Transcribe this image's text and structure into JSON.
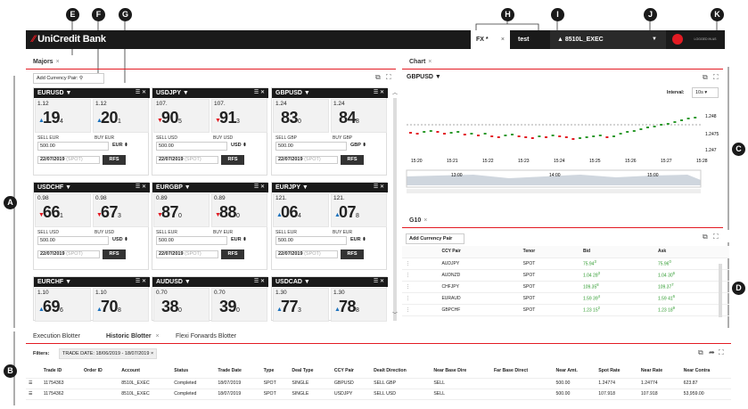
{
  "markers": [
    "A",
    "B",
    "C",
    "D",
    "E",
    "F",
    "G",
    "H",
    "I",
    "J",
    "K"
  ],
  "header": {
    "logo_brand": "UniCredit",
    "logo_sub": "Bank",
    "tab_fx": "FX *",
    "tab_close": "×",
    "tab_test": "test",
    "user": "8510L_EXEC",
    "logged_in": "LOGGED IN AS"
  },
  "majors": {
    "tab": "Majors",
    "close": "×",
    "add_pair": "Add Currency Pair:"
  },
  "tiles": [
    {
      "pair": "EURUSD",
      "bid_big": "1.12",
      "bid_pips": "19",
      "bid_sub": "4",
      "ask_big": "1.12",
      "ask_pips": "20",
      "ask_sub": "1",
      "bid_dir": "up",
      "ask_dir": "up",
      "sell": "SELL EUR",
      "buy": "BUY EUR",
      "amount": "500.00",
      "ccy": "EUR",
      "date": "22/07/2019",
      "spot": "(SPOT)",
      "rfs": "RFS"
    },
    {
      "pair": "USDJPY",
      "bid_big": "107.",
      "bid_pips": "90",
      "bid_sub": "5",
      "ask_big": "107.",
      "ask_pips": "91",
      "ask_sub": "3",
      "bid_dir": "dn",
      "ask_dir": "dn",
      "sell": "SELL USD",
      "buy": "BUY USD",
      "amount": "500.00",
      "ccy": "USD",
      "date": "22/07/2019",
      "spot": "(SPOT)",
      "rfs": "RFS"
    },
    {
      "pair": "GBPUSD",
      "bid_big": "1.24",
      "bid_pips": "83",
      "bid_sub": "0",
      "ask_big": "1.24",
      "ask_pips": "84",
      "ask_sub": "8",
      "bid_dir": "",
      "ask_dir": "",
      "sell": "SELL GBP",
      "buy": "BUY GBP",
      "amount": "500.00",
      "ccy": "GBP",
      "date": "22/07/2019",
      "spot": "(SPOT)",
      "rfs": "RFS"
    },
    {
      "pair": "USDCHF",
      "bid_big": "0.98",
      "bid_pips": "66",
      "bid_sub": "1",
      "ask_big": "0.98",
      "ask_pips": "67",
      "ask_sub": "3",
      "bid_dir": "dn",
      "ask_dir": "dn",
      "sell": "SELL USD",
      "buy": "BUY USD",
      "amount": "500.00",
      "ccy": "USD",
      "date": "22/07/2019",
      "spot": "(SPOT)",
      "rfs": "RFS"
    },
    {
      "pair": "EURGBP",
      "bid_big": "0.89",
      "bid_pips": "87",
      "bid_sub": "0",
      "ask_big": "0.89",
      "ask_pips": "88",
      "ask_sub": "0",
      "bid_dir": "dn",
      "ask_dir": "dn",
      "sell": "SELL EUR",
      "buy": "BUY EUR",
      "amount": "500.00",
      "ccy": "EUR",
      "date": "22/07/2019",
      "spot": "(SPOT)",
      "rfs": "RFS"
    },
    {
      "pair": "EURJPY",
      "bid_big": "121.",
      "bid_pips": "06",
      "bid_sub": "4",
      "ask_big": "121.",
      "ask_pips": "07",
      "ask_sub": "8",
      "bid_dir": "up",
      "ask_dir": "up",
      "sell": "SELL EUR",
      "buy": "BUY EUR",
      "amount": "500.00",
      "ccy": "EUR",
      "date": "22/07/2019",
      "spot": "(SPOT)",
      "rfs": "RFS"
    },
    {
      "pair": "EURCHF",
      "bid_big": "1.10",
      "bid_pips": "69",
      "bid_sub": "6",
      "ask_big": "1.10",
      "ask_pips": "70",
      "ask_sub": "8",
      "bid_dir": "up",
      "ask_dir": "up"
    },
    {
      "pair": "AUDUSD",
      "bid_big": "0.70",
      "bid_pips": "38",
      "bid_sub": "0",
      "ask_big": "0.70",
      "ask_pips": "39",
      "ask_sub": "0",
      "bid_dir": "",
      "ask_dir": ""
    },
    {
      "pair": "USDCAD",
      "bid_big": "1.30",
      "bid_pips": "77",
      "bid_sub": "3",
      "ask_big": "1.30",
      "ask_pips": "78",
      "ask_sub": "8",
      "bid_dir": "up",
      "ask_dir": "up"
    }
  ],
  "chart": {
    "tab": "Chart",
    "close": "×",
    "pair": "GBPUSD",
    "interval_label": "Interval:",
    "interval": "10s",
    "y_labels": [
      "1.248",
      "1.2475",
      "1.247"
    ],
    "x_labels": [
      "15:20",
      "15:21",
      "15:22",
      "15:23",
      "15:24",
      "15:25",
      "15:26",
      "15:27",
      "15:28"
    ],
    "nav_labels": [
      "13:00",
      "14:00",
      "15:00"
    ]
  },
  "g10": {
    "tab": "G10",
    "close": "×",
    "add_pair": "Add Currency Pair",
    "cols": [
      "CCY Pair",
      "Tenor",
      "Bid",
      "Ask"
    ],
    "rows": [
      [
        "AUDJPY",
        "SPOT",
        "75.94",
        "3",
        "75.96",
        "0"
      ],
      [
        "AUDNZD",
        "SPOT",
        "1.04 28",
        "3",
        "1.04 30",
        "6"
      ],
      [
        "CHFJPY",
        "SPOT",
        "109.35",
        "8",
        "109.37",
        "7"
      ],
      [
        "EURAUD",
        "SPOT",
        "1.59 39",
        "4",
        "1.59 41",
        "6"
      ],
      [
        "GBPCHF",
        "SPOT",
        "1.23 15",
        "2",
        "1.23 18",
        "9"
      ]
    ]
  },
  "blotter": {
    "tabs": [
      "Execution Blotter",
      "Historic Blotter",
      "Flexi Forwards Blotter"
    ],
    "close": "×",
    "filters": "Filters:",
    "filter_chip": "TRADE DATE: 18/06/2019 - 18/07/2019",
    "cols": [
      "Trade ID",
      "Order ID",
      "Account",
      "Status",
      "Trade Date",
      "Type",
      "Deal Type",
      "CCY Pair",
      "Dealt Direction",
      "Near Base Dire",
      "Far Base Direct",
      "Near Amt.",
      "Spot Rate",
      "Near Rate",
      "Near Contra"
    ],
    "rows": [
      [
        "11754363",
        "",
        "8510L_EXEC",
        "Completed",
        "18/07/2019",
        "SPOT",
        "SINGLE",
        "GBPUSD",
        "SELL GBP",
        "SELL",
        "",
        "500.00",
        "1.24774",
        "1.24774",
        "623.87"
      ],
      [
        "11754362",
        "",
        "8510L_EXEC",
        "Completed",
        "18/07/2019",
        "SPOT",
        "SINGLE",
        "USDJPY",
        "SELL USD",
        "SELL",
        "",
        "500.00",
        "107.918",
        "107.918",
        "53,959.00"
      ]
    ]
  }
}
